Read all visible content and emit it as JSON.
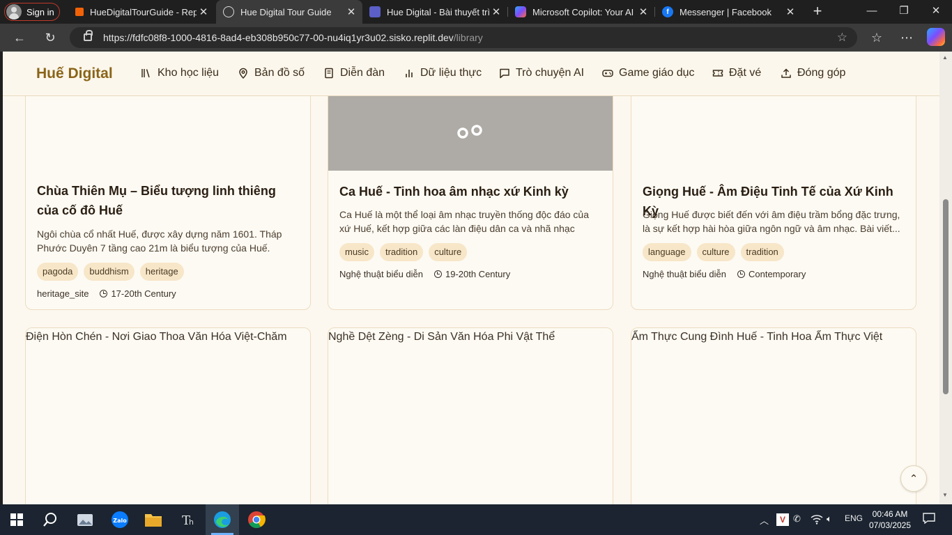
{
  "browser": {
    "signin_label": "Sign in",
    "tabs": [
      {
        "title": "HueDigitalTourGuide - Replit",
        "favicon": "replit-icon"
      },
      {
        "title": "Hue Digital Tour Guide",
        "favicon": "globe-icon"
      },
      {
        "title": "Hue Digital - Bài thuyết trình",
        "favicon": "slides-icon"
      },
      {
        "title": "Microsoft Copilot: Your AI co",
        "favicon": "copilot-icon"
      },
      {
        "title": "Messenger | Facebook",
        "favicon": "facebook-icon"
      }
    ],
    "url_host": "https://fdfc08f8-1000-4816-8ad4-eb308b950c77-00-nu4iq1yr3u02.sisko.replit.dev",
    "url_path": "/library"
  },
  "nav": {
    "logo": "Huế Digital",
    "items": [
      {
        "label": "Kho học liệu",
        "icon": "library-icon"
      },
      {
        "label": "Bản đồ số",
        "icon": "map-pin-icon"
      },
      {
        "label": "Diễn đàn",
        "icon": "book-icon"
      },
      {
        "label": "Dữ liệu thực",
        "icon": "bar-chart-icon"
      },
      {
        "label": "Trò chuyện AI",
        "icon": "chat-icon"
      },
      {
        "label": "Game giáo dục",
        "icon": "gamepad-icon"
      },
      {
        "label": "Đặt vé",
        "icon": "ticket-icon"
      },
      {
        "label": "Đóng góp",
        "icon": "upload-icon"
      }
    ]
  },
  "cards": [
    {
      "title": "Chùa Thiên Mụ – Biểu tượng linh thiêng của cố đô Huế",
      "desc": "Ngôi chùa cổ nhất Huế, được xây dựng năm 1601. Tháp Phước Duyên 7 tầng cao 21m là biểu tượng của Huế. Chùa...",
      "tags": [
        "pagoda",
        "buddhism",
        "heritage"
      ],
      "category": "heritage_site",
      "era": "17-20th Century"
    },
    {
      "title": "Ca Huế - Tinh hoa âm nhạc xứ Kinh kỳ",
      "desc": "Ca Huế là một thể loại âm nhạc truyền thống độc đáo của xứ Huế, kết hợp giữa các làn điệu dân ca và nhã nhạc cung...",
      "tags": [
        "music",
        "tradition",
        "culture"
      ],
      "category": "Nghệ thuật biểu diễn",
      "era": "19-20th Century"
    },
    {
      "title": "Giọng Huế - Âm Điệu Tinh Tế của Xứ Kinh Kỳ",
      "desc": "Giọng Huế được biết đến với âm điệu trầm bổng đặc trưng, là sự kết hợp hài hòa giữa ngôn ngữ và âm nhạc. Bài viết...",
      "tags": [
        "language",
        "culture",
        "tradition"
      ],
      "category": "Nghệ thuật biểu diễn",
      "era": "Contemporary"
    }
  ],
  "next_cards": [
    {
      "image_alt": "Điện Hòn Chén - Nơi Giao Thoa Văn Hóa Việt-Chăm"
    },
    {
      "image_alt": "Nghề Dệt Zèng - Di Sản Văn Hóa Phi Vật Thể"
    },
    {
      "image_alt": "Ẩm Thực Cung Đình Huế - Tinh Hoa Ẩm Thực Việt"
    }
  ],
  "taskbar": {
    "lang": "ENG",
    "time": "00:46 AM",
    "date": "07/03/2025"
  },
  "colors": {
    "page_bg": "#fcf8f0",
    "accent": "#8a6418",
    "tag_bg": "#f7e6c8",
    "card_border": "#eddcc0"
  }
}
